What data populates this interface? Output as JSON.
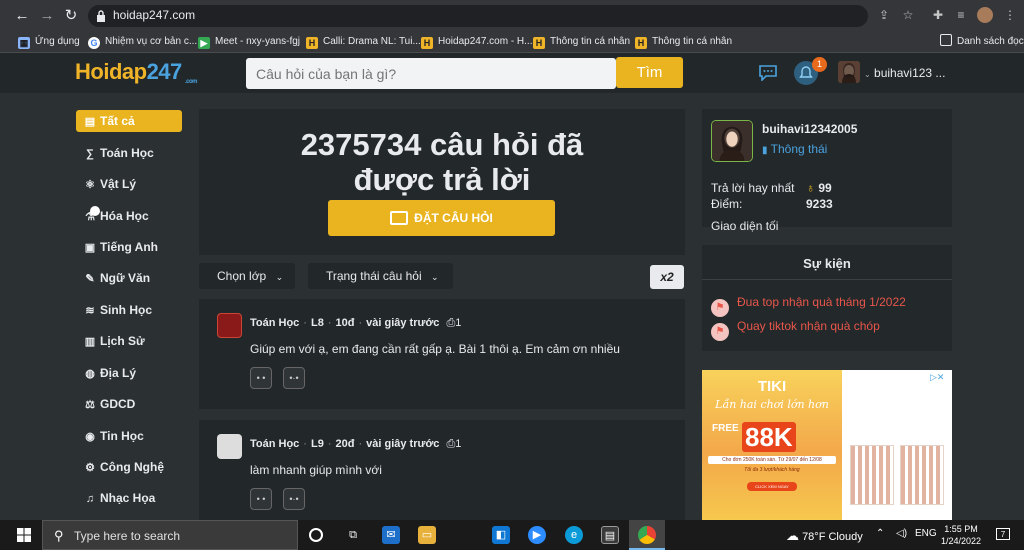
{
  "browser": {
    "url": "hoidap247.com",
    "bookmarks": [
      "Ứng dụng",
      "Nhiệm vụ cơ bản c...",
      "Meet - nxy-yans-fgj",
      "Calli: Drama NL: Tui...",
      "Hoidap247.com - H...",
      "Thông tin cá nhân",
      "Thông tin cá nhân"
    ],
    "reading_list": "Danh sách đọc"
  },
  "header": {
    "logo_part1": "Hoidap",
    "logo_part2": "247",
    "logo_suffix": ".com",
    "search_placeholder": "Câu hỏi của bạn là gì?",
    "search_button": "Tìm",
    "notification_count": "1",
    "username": "buihavi123 ..."
  },
  "sidebar": {
    "items": [
      {
        "label": "Tất cả",
        "icon": "grid-icon"
      },
      {
        "label": "Toán Học",
        "icon": "math-icon"
      },
      {
        "label": "Vật Lý",
        "icon": "atom-icon"
      },
      {
        "label": "Hóa Học",
        "icon": "flask-icon"
      },
      {
        "label": "Tiếng Anh",
        "icon": "language-icon"
      },
      {
        "label": "Ngữ Văn",
        "icon": "pen-icon"
      },
      {
        "label": "Sinh Học",
        "icon": "dna-icon"
      },
      {
        "label": "Lịch Sử",
        "icon": "scroll-icon"
      },
      {
        "label": "Địa Lý",
        "icon": "globe-icon"
      },
      {
        "label": "GDCD",
        "icon": "scale-icon"
      },
      {
        "label": "Tin Học",
        "icon": "computer-icon"
      },
      {
        "label": "Công Nghệ",
        "icon": "gear-icon"
      },
      {
        "label": "Nhạc Họa",
        "icon": "music-icon"
      }
    ]
  },
  "hero": {
    "title_line1": "2375734 câu hỏi đã",
    "title_line2": "được trả lời",
    "ask_button": "ĐẶT CÂU HỎI"
  },
  "filters": {
    "grade": "Chọn lớp",
    "status": "Trạng thái câu hỏi",
    "multiplier": "x2"
  },
  "questions": [
    {
      "subject": "Toán Học",
      "grade": "L8",
      "points": "10đ",
      "time": "vài giây trước",
      "attachments": "1",
      "text": "Giúp em với ạ, em đang cần rất gấp ạ. Bài 1 thôi ạ. Em cảm ơn nhiều"
    },
    {
      "subject": "Toán Học",
      "grade": "L9",
      "points": "20đ",
      "time": "vài giây trước",
      "attachments": "1",
      "text": "làm nhanh giúp mình với"
    }
  ],
  "profile": {
    "username": "buihavi12342005",
    "status": "Thông thái",
    "best_answers_label": "Trả lời hay nhất",
    "best_answers_value": "99",
    "points_label": "Điểm:",
    "points_value": "9233",
    "dark_mode_label": "Giao diện tối"
  },
  "events": {
    "title": "Sự kiện",
    "items": [
      "Đua top nhận quà tháng 1/2022",
      "Quay tiktok nhận quà chóp"
    ]
  },
  "ad": {
    "brand": "TIKI",
    "slogan": "Lần hai chơi lớn hơn",
    "free_ship": "FREE SHIP",
    "amount": "88K",
    "fine_print": "Cho đơn 250K toàn sàn. Từ 29/07 đến 12/08",
    "fine_print2": "Tối đa 3 lượt/khách hàng",
    "button": "CLICK XEM NGAY"
  },
  "taskbar": {
    "search_placeholder": "Type here to search",
    "weather": "78°F  Cloudy",
    "language": "ENG",
    "time": "1:55 PM",
    "date": "1/24/2022",
    "notifications": "7"
  }
}
